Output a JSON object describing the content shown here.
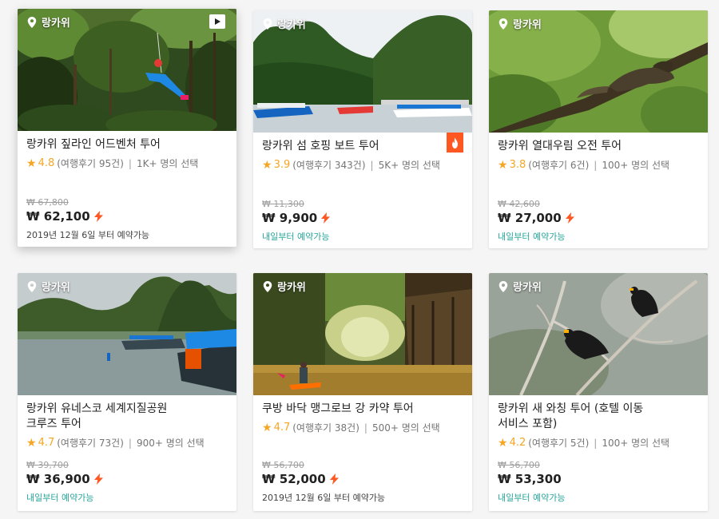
{
  "colors": {
    "accent": "#ff5722",
    "star": "#f6a623",
    "available": "#26a69a"
  },
  "cards": [
    {
      "location": "랑카위",
      "title": "랑카위 짚라인 어드벤처 투어",
      "rating": "4.8",
      "reviews": "(여행후기 95건)",
      "chosen": "1K+ 명의 선택",
      "old_price": "₩ 67,800",
      "price": "₩ 62,100",
      "availability": "2019년 12월 6일 부터 예약가능",
      "availability_type": "date",
      "icons": [
        "location-pin-icon",
        "play-video-icon",
        "lightning-icon"
      ]
    },
    {
      "location": "랑카위",
      "title": "랑카위 섬 호핑 보트 투어",
      "rating": "3.9",
      "reviews": "(여행후기 343건)",
      "chosen": "5K+ 명의 선택",
      "old_price": "₩ 11,300",
      "price": "₩ 9,900",
      "availability": "내일부터 예약가능",
      "availability_type": "tomorrow",
      "icons": [
        "location-pin-icon",
        "hot-fire-icon",
        "lightning-icon"
      ]
    },
    {
      "location": "랑카위",
      "title": "랑카위 열대우림 오전 투어",
      "rating": "3.8",
      "reviews": "(여행후기 6건)",
      "chosen": "100+ 명의 선택",
      "old_price": "₩ 42,600",
      "price": "₩ 27,000",
      "availability": "내일부터 예약가능",
      "availability_type": "tomorrow",
      "icons": [
        "location-pin-icon",
        "lightning-icon"
      ]
    },
    {
      "location": "랑카위",
      "title_line1": "랑카위 유네스코 세계지질공원",
      "title_line2": "크루즈 투어",
      "rating": "4.7",
      "reviews": "(여행후기 73건)",
      "chosen": "900+ 명의 선택",
      "old_price": "₩ 39,700",
      "price": "₩ 36,900",
      "availability": "내일부터 예약가능",
      "availability_type": "tomorrow",
      "icons": [
        "location-pin-icon",
        "lightning-icon"
      ]
    },
    {
      "location": "랑카위",
      "title": "쿠방 바닥 맹그로브 강 카약 투어",
      "rating": "4.7",
      "reviews": "(여행후기 38건)",
      "chosen": "500+ 명의 선택",
      "old_price": "₩ 56,700",
      "price": "₩ 52,000",
      "availability": "2019년 12월 6일 부터 예약가능",
      "availability_type": "date",
      "icons": [
        "location-pin-icon",
        "lightning-icon"
      ]
    },
    {
      "location": "랑카위",
      "title_line1": "랑카위 새 와칭 투어 (호텔 이동",
      "title_line2": "서비스 포함)",
      "rating": "4.2",
      "reviews": "(여행후기 5건)",
      "chosen": "100+ 명의 선택",
      "old_price": "₩ 56,700",
      "price": "₩ 53,300",
      "availability": "내일부터 예약가능",
      "availability_type": "tomorrow",
      "icons": [
        "location-pin-icon"
      ]
    }
  ]
}
